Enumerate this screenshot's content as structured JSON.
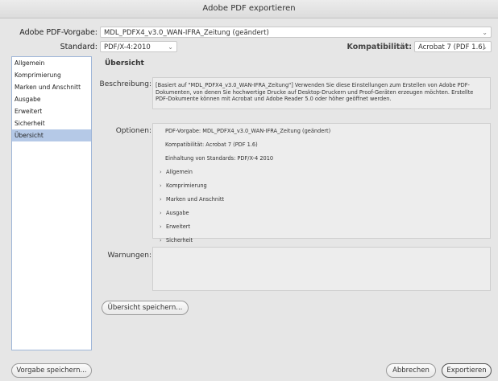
{
  "window": {
    "title": "Adobe PDF exportieren"
  },
  "preset": {
    "label": "Adobe PDF-Vorgabe:",
    "value": "MDL_PDFX4_v3.0_WAN-IFRA_Zeitung (geändert)"
  },
  "standard": {
    "label": "Standard:",
    "value": "PDF/X-4:2010"
  },
  "compatibility": {
    "label": "Kompatibilität:",
    "value": "Acrobat 7 (PDF 1.6)"
  },
  "sidebar": {
    "items": [
      {
        "label": "Allgemein"
      },
      {
        "label": "Komprimierung"
      },
      {
        "label": "Marken und Anschnitt"
      },
      {
        "label": "Ausgabe"
      },
      {
        "label": "Erweitert"
      },
      {
        "label": "Sicherheit"
      },
      {
        "label": "Übersicht"
      }
    ],
    "selected_index": 6
  },
  "main": {
    "title": "Übersicht",
    "description_label": "Beschreibung:",
    "description_text": "[Basiert auf \"MDL_PDFX4_v3.0_WAN-IFRA_Zeitung\"] Verwenden Sie diese Einstellungen zum Erstellen von Adobe PDF-Dokumenten, von denen Sie hochwertige Drucke auf Desktop-Druckern und Proof-Geräten erzeugen möchten. Erstellte PDF-Dokumente können mit Acrobat und Adobe Reader 5.0 oder höher geöffnet werden.",
    "options_label": "Optionen:",
    "options": {
      "line1": "PDF-Vorgabe: MDL_PDFX4_v3.0_WAN-IFRA_Zeitung (geändert)",
      "line2": "Kompatibilität: Acrobat 7 (PDF 1.6)",
      "line3": "Einhaltung von Standards: PDF/X-4 2010",
      "groups": [
        "Allgemein",
        "Komprimierung",
        "Marken und Anschnitt",
        "Ausgabe",
        "Erweitert",
        "Sicherheit"
      ]
    },
    "warnings_label": "Warnungen:",
    "save_summary_label": "Übersicht speichern..."
  },
  "footer": {
    "save_preset_label": "Vorgabe speichern...",
    "cancel_label": "Abbrechen",
    "export_label": "Exportieren"
  },
  "icons": {
    "disclosure": "disclosure-triangle-icon",
    "dropdown": "chevron-down-icon"
  }
}
